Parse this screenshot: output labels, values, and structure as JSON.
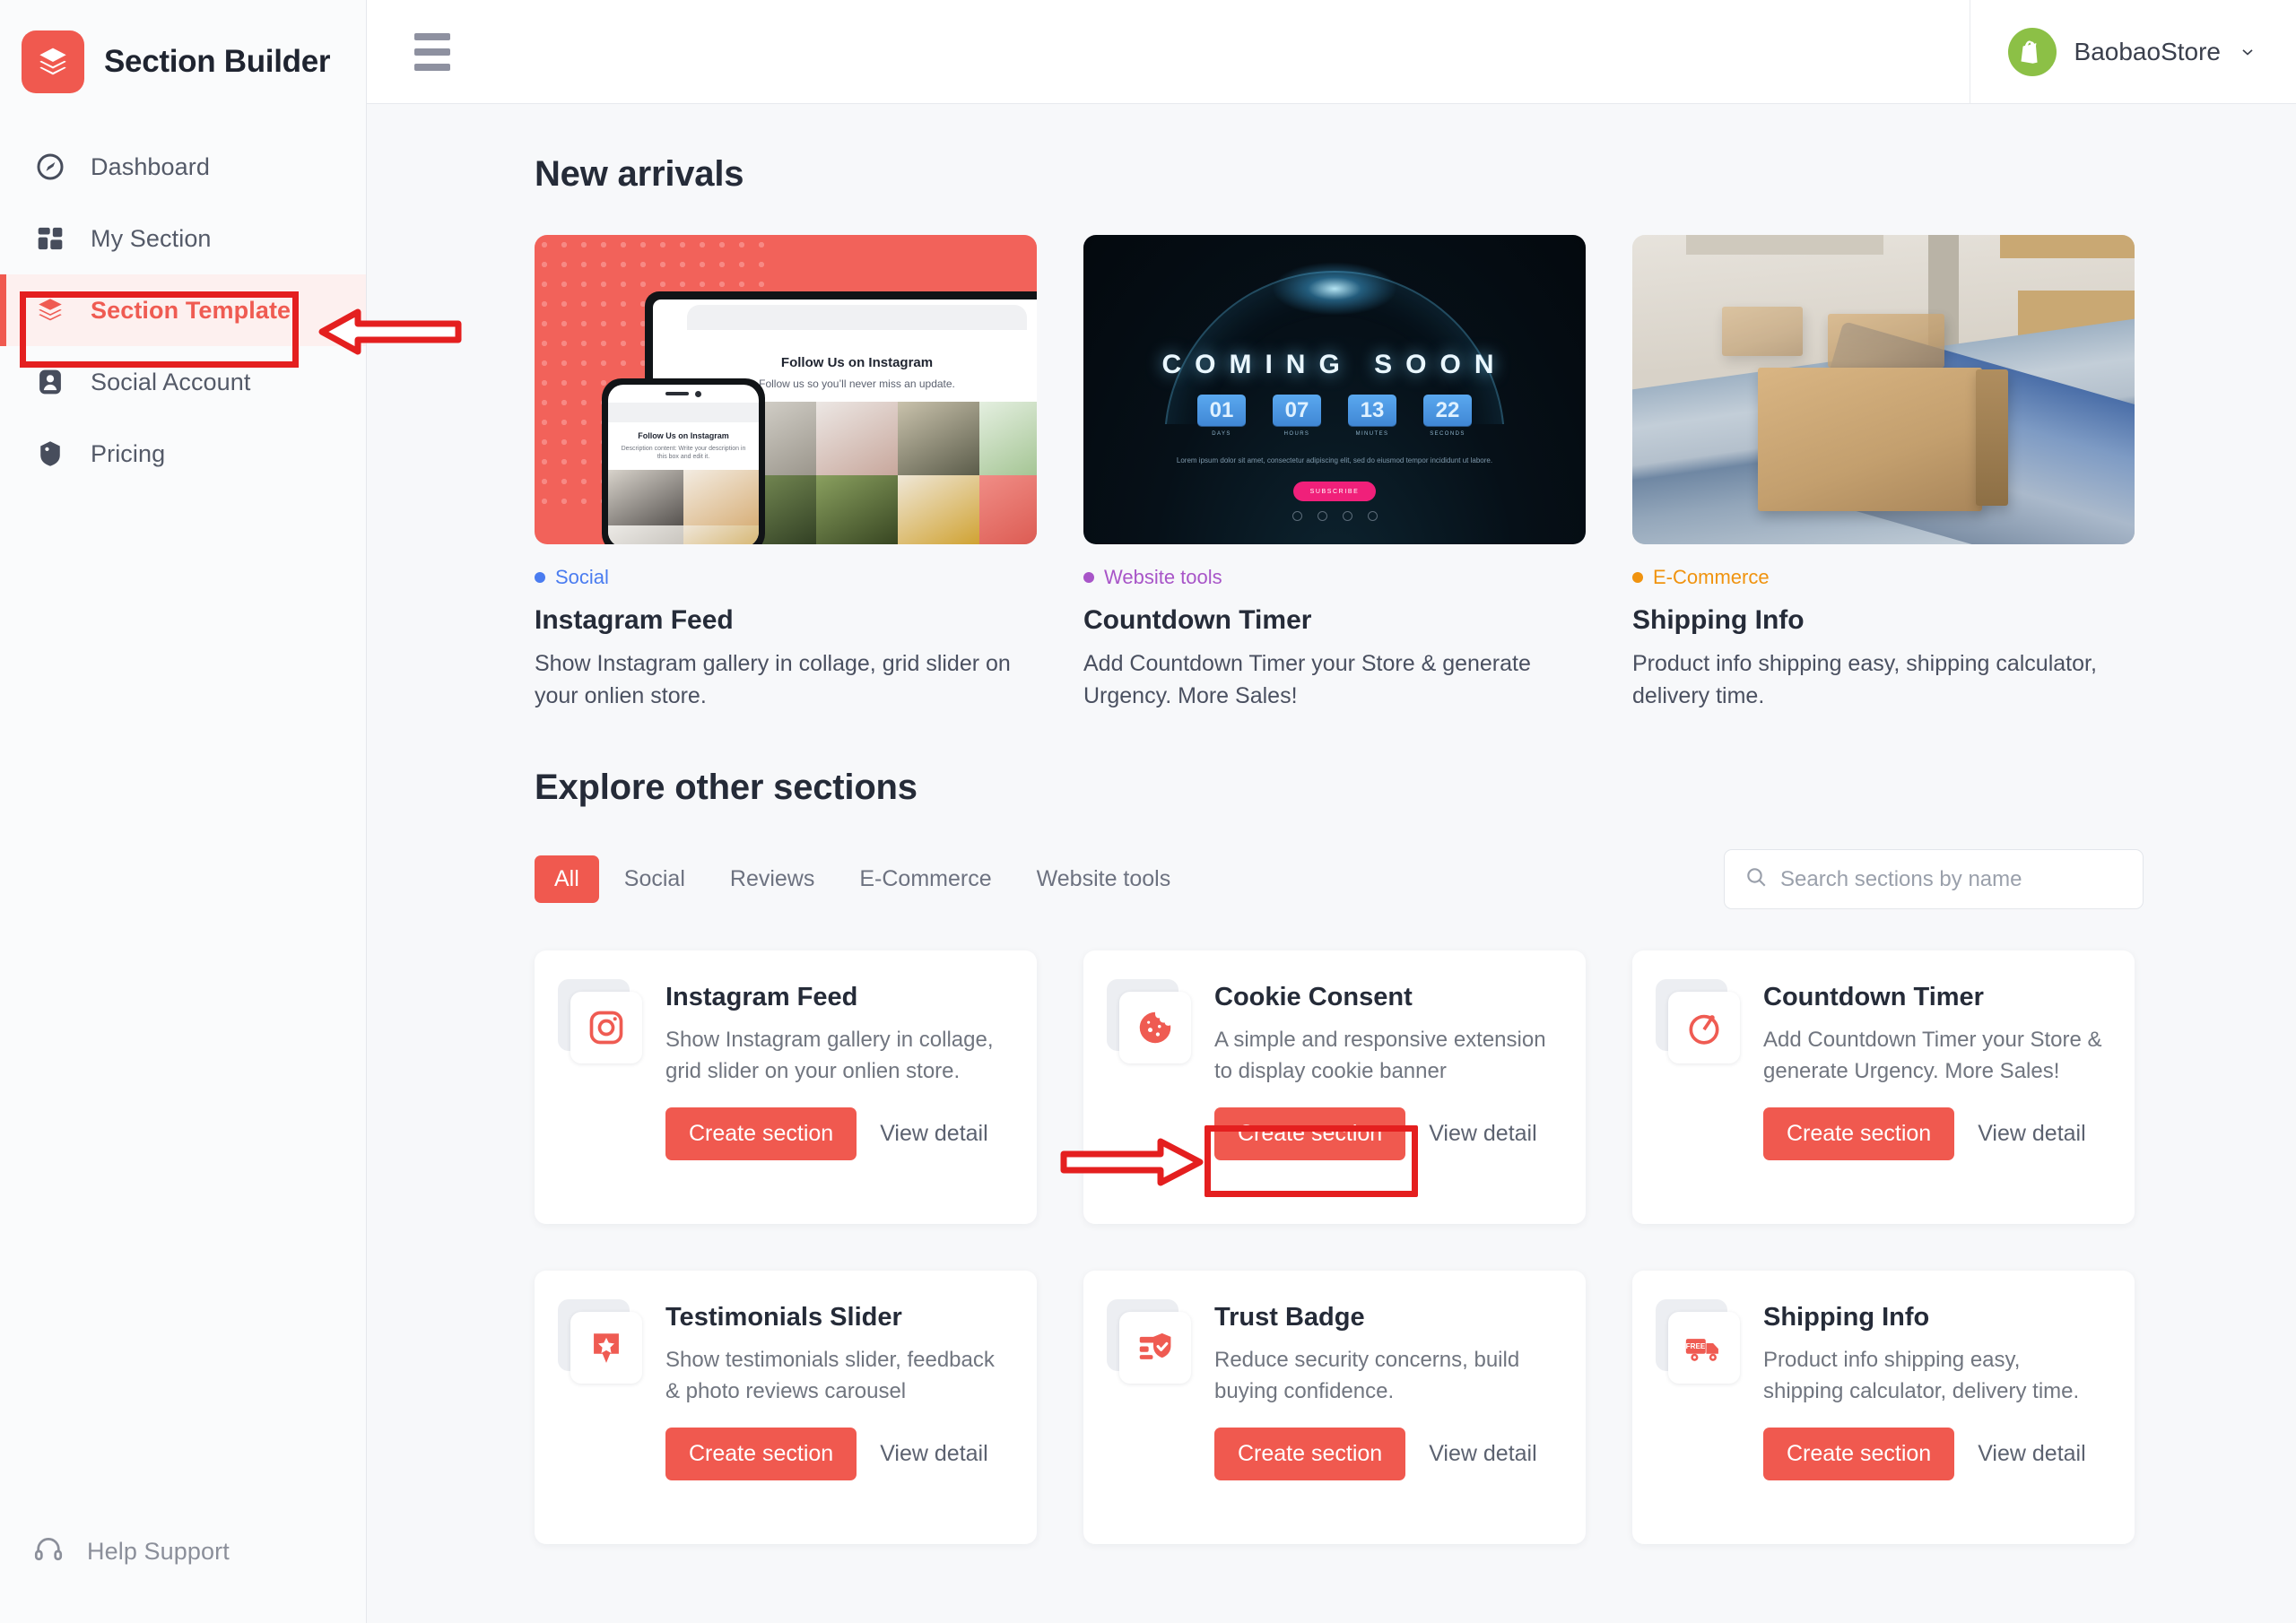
{
  "brand": {
    "name": "Section Builder",
    "logo_icon": "layers-logo-icon",
    "accent": "#f0594f"
  },
  "sidebar": {
    "items": [
      {
        "label": "Dashboard",
        "icon": "speedometer-icon",
        "active": false
      },
      {
        "label": "My Section",
        "icon": "grid-blocks-icon",
        "active": false
      },
      {
        "label": "Section Template",
        "icon": "layers-icon",
        "active": true
      },
      {
        "label": "Social Account",
        "icon": "user-badge-icon",
        "active": false
      },
      {
        "label": "Pricing",
        "icon": "price-tag-icon",
        "active": false
      }
    ],
    "help": {
      "label": "Help Support",
      "icon": "headset-icon"
    }
  },
  "topbar": {
    "menu_icon": "hamburger-icon",
    "account_name": "BaobaoStore",
    "account_avatar_icon": "shopify-bag-icon",
    "chevron_icon": "chevron-down-icon",
    "avatar_color": "#8cc046"
  },
  "new_arrivals": {
    "title": "New arrivals",
    "items": [
      {
        "category": "Social",
        "category_color": "#4a7cf0",
        "name": "Instagram Feed",
        "description": "Show Instagram gallery in collage, grid slider on your onlien store.",
        "thumb": "instagram-promo-thumb",
        "thumb_text": {
          "heading": "Follow Us on Instagram",
          "sub": "Follow us so you’ll never miss an update.",
          "phone_heading": "Follow Us on Instagram",
          "phone_sub": "Description content: Write your description in this box and edit it."
        }
      },
      {
        "category": "Website tools",
        "category_color": "#a855c8",
        "name": "Countdown Timer",
        "description": "Add Countdown Timer your Store & generate Urgency. More Sales!",
        "thumb": "coming-soon-thumb",
        "thumb_text": {
          "title": "COMING SOON",
          "timer": [
            {
              "value": "01",
              "label": "DAYS"
            },
            {
              "value": "07",
              "label": "HOURS"
            },
            {
              "value": "13",
              "label": "MINUTES"
            },
            {
              "value": "22",
              "label": "SECONDS"
            }
          ],
          "paragraph": "Lorem ipsum dolor sit amet, consectetur adipiscing elit, sed do eiusmod tempor incididunt ut labore.",
          "button": "SUBSCRIBE"
        }
      },
      {
        "category": "E-Commerce",
        "category_color": "#f0930f",
        "name": "Shipping Info",
        "description": "Product info shipping easy, shipping calculator, delivery time.",
        "thumb": "warehouse-conveyor-thumb",
        "thumb_text": {}
      }
    ]
  },
  "explore": {
    "title": "Explore other sections",
    "tabs": [
      {
        "label": "All",
        "active": true
      },
      {
        "label": "Social",
        "active": false
      },
      {
        "label": "Reviews",
        "active": false
      },
      {
        "label": "E-Commerce",
        "active": false
      },
      {
        "label": "Website tools",
        "active": false
      }
    ],
    "search": {
      "placeholder": "Search sections by name",
      "value": "",
      "icon": "search-icon"
    },
    "cards": [
      {
        "icon": "instagram-icon",
        "title": "Instagram Feed",
        "description": "Show Instagram gallery in collage, grid slider on your onlien store.",
        "create_label": "Create section",
        "view_label": "View detail",
        "highlighted": false
      },
      {
        "icon": "cookie-icon",
        "title": "Cookie Consent",
        "description": "A simple and responsive extension to display cookie banner",
        "create_label": "Create section",
        "view_label": "View detail",
        "highlighted": true
      },
      {
        "icon": "stopwatch-icon",
        "title": "Countdown Timer",
        "description": "Add Countdown Timer your Store & generate Urgency. More Sales!",
        "create_label": "Create section",
        "view_label": "View detail",
        "highlighted": false
      },
      {
        "icon": "star-speech-bubble-icon",
        "title": "Testimonials Slider",
        "description": "Show testimonials slider, feedback & photo reviews carousel",
        "create_label": "Create section",
        "view_label": "View detail",
        "highlighted": false
      },
      {
        "icon": "shield-check-icon",
        "title": "Trust Badge",
        "description": "Reduce security concerns, build buying confidence.",
        "create_label": "Create section",
        "view_label": "View detail",
        "highlighted": false
      },
      {
        "icon": "free-delivery-truck-icon",
        "title": "Shipping Info",
        "description": "Product info shipping easy, shipping calculator, delivery time.",
        "create_label": "Create section",
        "view_label": "View detail",
        "highlighted": false
      }
    ]
  },
  "annotations": {
    "highlight_color": "#e41f1f",
    "boxes": [
      {
        "target": "sidebar-item-section-template"
      },
      {
        "target": "cookie-consent-create-section-button"
      }
    ],
    "arrows": [
      {
        "target": "sidebar-item-section-template",
        "direction": "left"
      },
      {
        "target": "cookie-consent-create-section-button",
        "direction": "right"
      }
    ]
  }
}
